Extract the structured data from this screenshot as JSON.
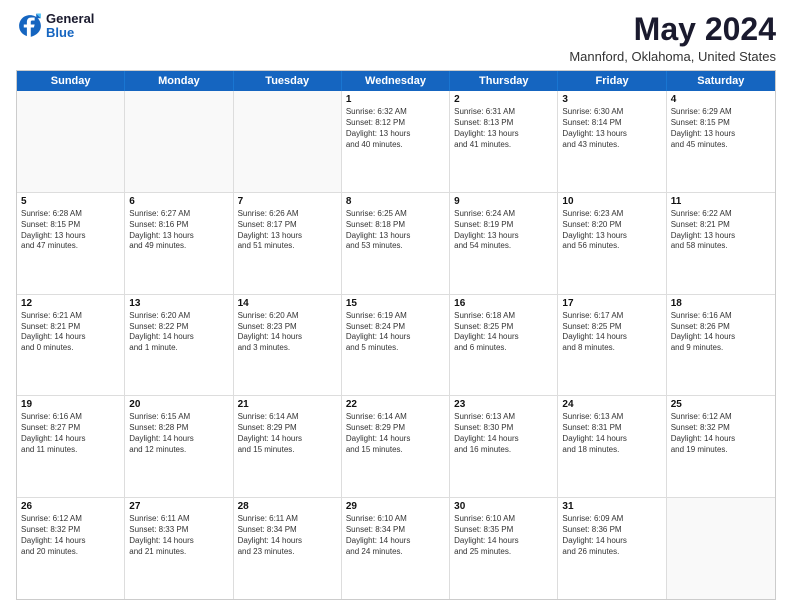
{
  "logo": {
    "general": "General",
    "blue": "Blue"
  },
  "header": {
    "month": "May 2024",
    "location": "Mannford, Oklahoma, United States"
  },
  "weekdays": [
    "Sunday",
    "Monday",
    "Tuesday",
    "Wednesday",
    "Thursday",
    "Friday",
    "Saturday"
  ],
  "weeks": [
    [
      {
        "day": "",
        "info": ""
      },
      {
        "day": "",
        "info": ""
      },
      {
        "day": "",
        "info": ""
      },
      {
        "day": "1",
        "info": "Sunrise: 6:32 AM\nSunset: 8:12 PM\nDaylight: 13 hours\nand 40 minutes."
      },
      {
        "day": "2",
        "info": "Sunrise: 6:31 AM\nSunset: 8:13 PM\nDaylight: 13 hours\nand 41 minutes."
      },
      {
        "day": "3",
        "info": "Sunrise: 6:30 AM\nSunset: 8:14 PM\nDaylight: 13 hours\nand 43 minutes."
      },
      {
        "day": "4",
        "info": "Sunrise: 6:29 AM\nSunset: 8:15 PM\nDaylight: 13 hours\nand 45 minutes."
      }
    ],
    [
      {
        "day": "5",
        "info": "Sunrise: 6:28 AM\nSunset: 8:15 PM\nDaylight: 13 hours\nand 47 minutes."
      },
      {
        "day": "6",
        "info": "Sunrise: 6:27 AM\nSunset: 8:16 PM\nDaylight: 13 hours\nand 49 minutes."
      },
      {
        "day": "7",
        "info": "Sunrise: 6:26 AM\nSunset: 8:17 PM\nDaylight: 13 hours\nand 51 minutes."
      },
      {
        "day": "8",
        "info": "Sunrise: 6:25 AM\nSunset: 8:18 PM\nDaylight: 13 hours\nand 53 minutes."
      },
      {
        "day": "9",
        "info": "Sunrise: 6:24 AM\nSunset: 8:19 PM\nDaylight: 13 hours\nand 54 minutes."
      },
      {
        "day": "10",
        "info": "Sunrise: 6:23 AM\nSunset: 8:20 PM\nDaylight: 13 hours\nand 56 minutes."
      },
      {
        "day": "11",
        "info": "Sunrise: 6:22 AM\nSunset: 8:21 PM\nDaylight: 13 hours\nand 58 minutes."
      }
    ],
    [
      {
        "day": "12",
        "info": "Sunrise: 6:21 AM\nSunset: 8:21 PM\nDaylight: 14 hours\nand 0 minutes."
      },
      {
        "day": "13",
        "info": "Sunrise: 6:20 AM\nSunset: 8:22 PM\nDaylight: 14 hours\nand 1 minute."
      },
      {
        "day": "14",
        "info": "Sunrise: 6:20 AM\nSunset: 8:23 PM\nDaylight: 14 hours\nand 3 minutes."
      },
      {
        "day": "15",
        "info": "Sunrise: 6:19 AM\nSunset: 8:24 PM\nDaylight: 14 hours\nand 5 minutes."
      },
      {
        "day": "16",
        "info": "Sunrise: 6:18 AM\nSunset: 8:25 PM\nDaylight: 14 hours\nand 6 minutes."
      },
      {
        "day": "17",
        "info": "Sunrise: 6:17 AM\nSunset: 8:25 PM\nDaylight: 14 hours\nand 8 minutes."
      },
      {
        "day": "18",
        "info": "Sunrise: 6:16 AM\nSunset: 8:26 PM\nDaylight: 14 hours\nand 9 minutes."
      }
    ],
    [
      {
        "day": "19",
        "info": "Sunrise: 6:16 AM\nSunset: 8:27 PM\nDaylight: 14 hours\nand 11 minutes."
      },
      {
        "day": "20",
        "info": "Sunrise: 6:15 AM\nSunset: 8:28 PM\nDaylight: 14 hours\nand 12 minutes."
      },
      {
        "day": "21",
        "info": "Sunrise: 6:14 AM\nSunset: 8:29 PM\nDaylight: 14 hours\nand 15 minutes."
      },
      {
        "day": "22",
        "info": "Sunrise: 6:14 AM\nSunset: 8:29 PM\nDaylight: 14 hours\nand 15 minutes."
      },
      {
        "day": "23",
        "info": "Sunrise: 6:13 AM\nSunset: 8:30 PM\nDaylight: 14 hours\nand 16 minutes."
      },
      {
        "day": "24",
        "info": "Sunrise: 6:13 AM\nSunset: 8:31 PM\nDaylight: 14 hours\nand 18 minutes."
      },
      {
        "day": "25",
        "info": "Sunrise: 6:12 AM\nSunset: 8:32 PM\nDaylight: 14 hours\nand 19 minutes."
      }
    ],
    [
      {
        "day": "26",
        "info": "Sunrise: 6:12 AM\nSunset: 8:32 PM\nDaylight: 14 hours\nand 20 minutes."
      },
      {
        "day": "27",
        "info": "Sunrise: 6:11 AM\nSunset: 8:33 PM\nDaylight: 14 hours\nand 21 minutes."
      },
      {
        "day": "28",
        "info": "Sunrise: 6:11 AM\nSunset: 8:34 PM\nDaylight: 14 hours\nand 23 minutes."
      },
      {
        "day": "29",
        "info": "Sunrise: 6:10 AM\nSunset: 8:34 PM\nDaylight: 14 hours\nand 24 minutes."
      },
      {
        "day": "30",
        "info": "Sunrise: 6:10 AM\nSunset: 8:35 PM\nDaylight: 14 hours\nand 25 minutes."
      },
      {
        "day": "31",
        "info": "Sunrise: 6:09 AM\nSunset: 8:36 PM\nDaylight: 14 hours\nand 26 minutes."
      },
      {
        "day": "",
        "info": ""
      }
    ]
  ]
}
